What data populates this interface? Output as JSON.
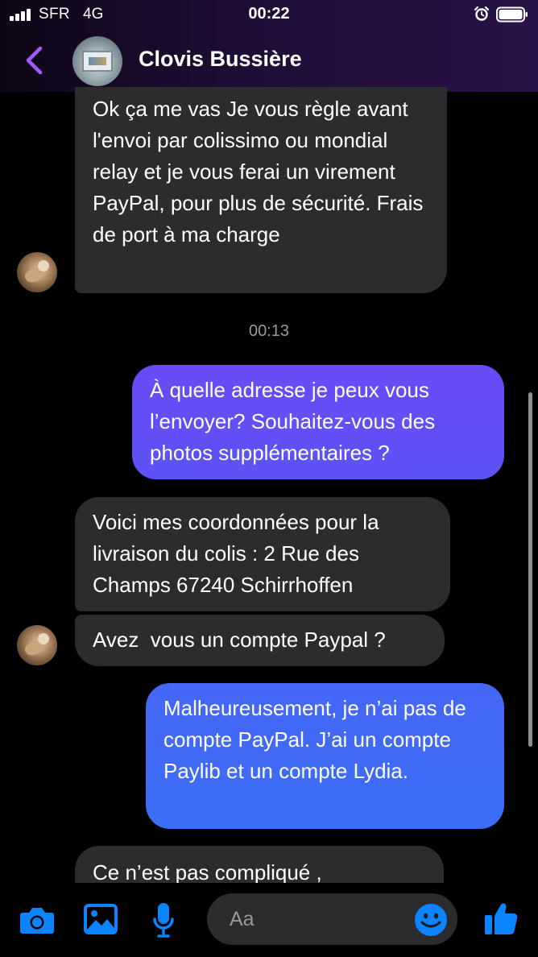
{
  "status_bar": {
    "carrier": "SFR",
    "network": "4G",
    "time": "00:22"
  },
  "header": {
    "contact_name": "Clovis Bussière"
  },
  "messages": [
    {
      "direction": "incoming",
      "text": "Ok ça me vas Je vous règle avant l'envoi par colissimo ou mondial relay et je vous ferai un virement PayPal, pour plus de sécurité. Frais de port à ma charge"
    },
    {
      "direction": "outgoing",
      "text": "À quelle adresse je peux vous l’envoyer? Souhaitez-vous des photos supplémentaires ?"
    },
    {
      "direction": "incoming",
      "text": "Voici mes coordonnées pour la livraison du colis : 2 Rue des Champs 67240 Schirrhoffen"
    },
    {
      "direction": "incoming",
      "text": "Avez  vous un compte Paypal ?"
    },
    {
      "direction": "outgoing",
      "text": "Malheureusement, je n’ai pas de compte PayPal. J’ai un compte Paylib et un compte Lydia."
    },
    {
      "direction": "incoming",
      "text": "Ce n’est pas compliqué ,"
    }
  ],
  "timestamp": "00:13",
  "composer": {
    "placeholder": "Aa"
  },
  "colors": {
    "accent": "#0a84ff",
    "back_chevron": "#a25bff",
    "incoming_bubble": "#2c2c2e",
    "outgoing_bubble_top": "#6a4af5",
    "outgoing_bubble_bottom": "#3b6ef6"
  },
  "icons": [
    "signal-icon",
    "alarm-icon",
    "battery-icon",
    "back-chevron-icon",
    "camera-icon",
    "image-icon",
    "microphone-icon",
    "emoji-icon",
    "thumbs-up-icon"
  ]
}
